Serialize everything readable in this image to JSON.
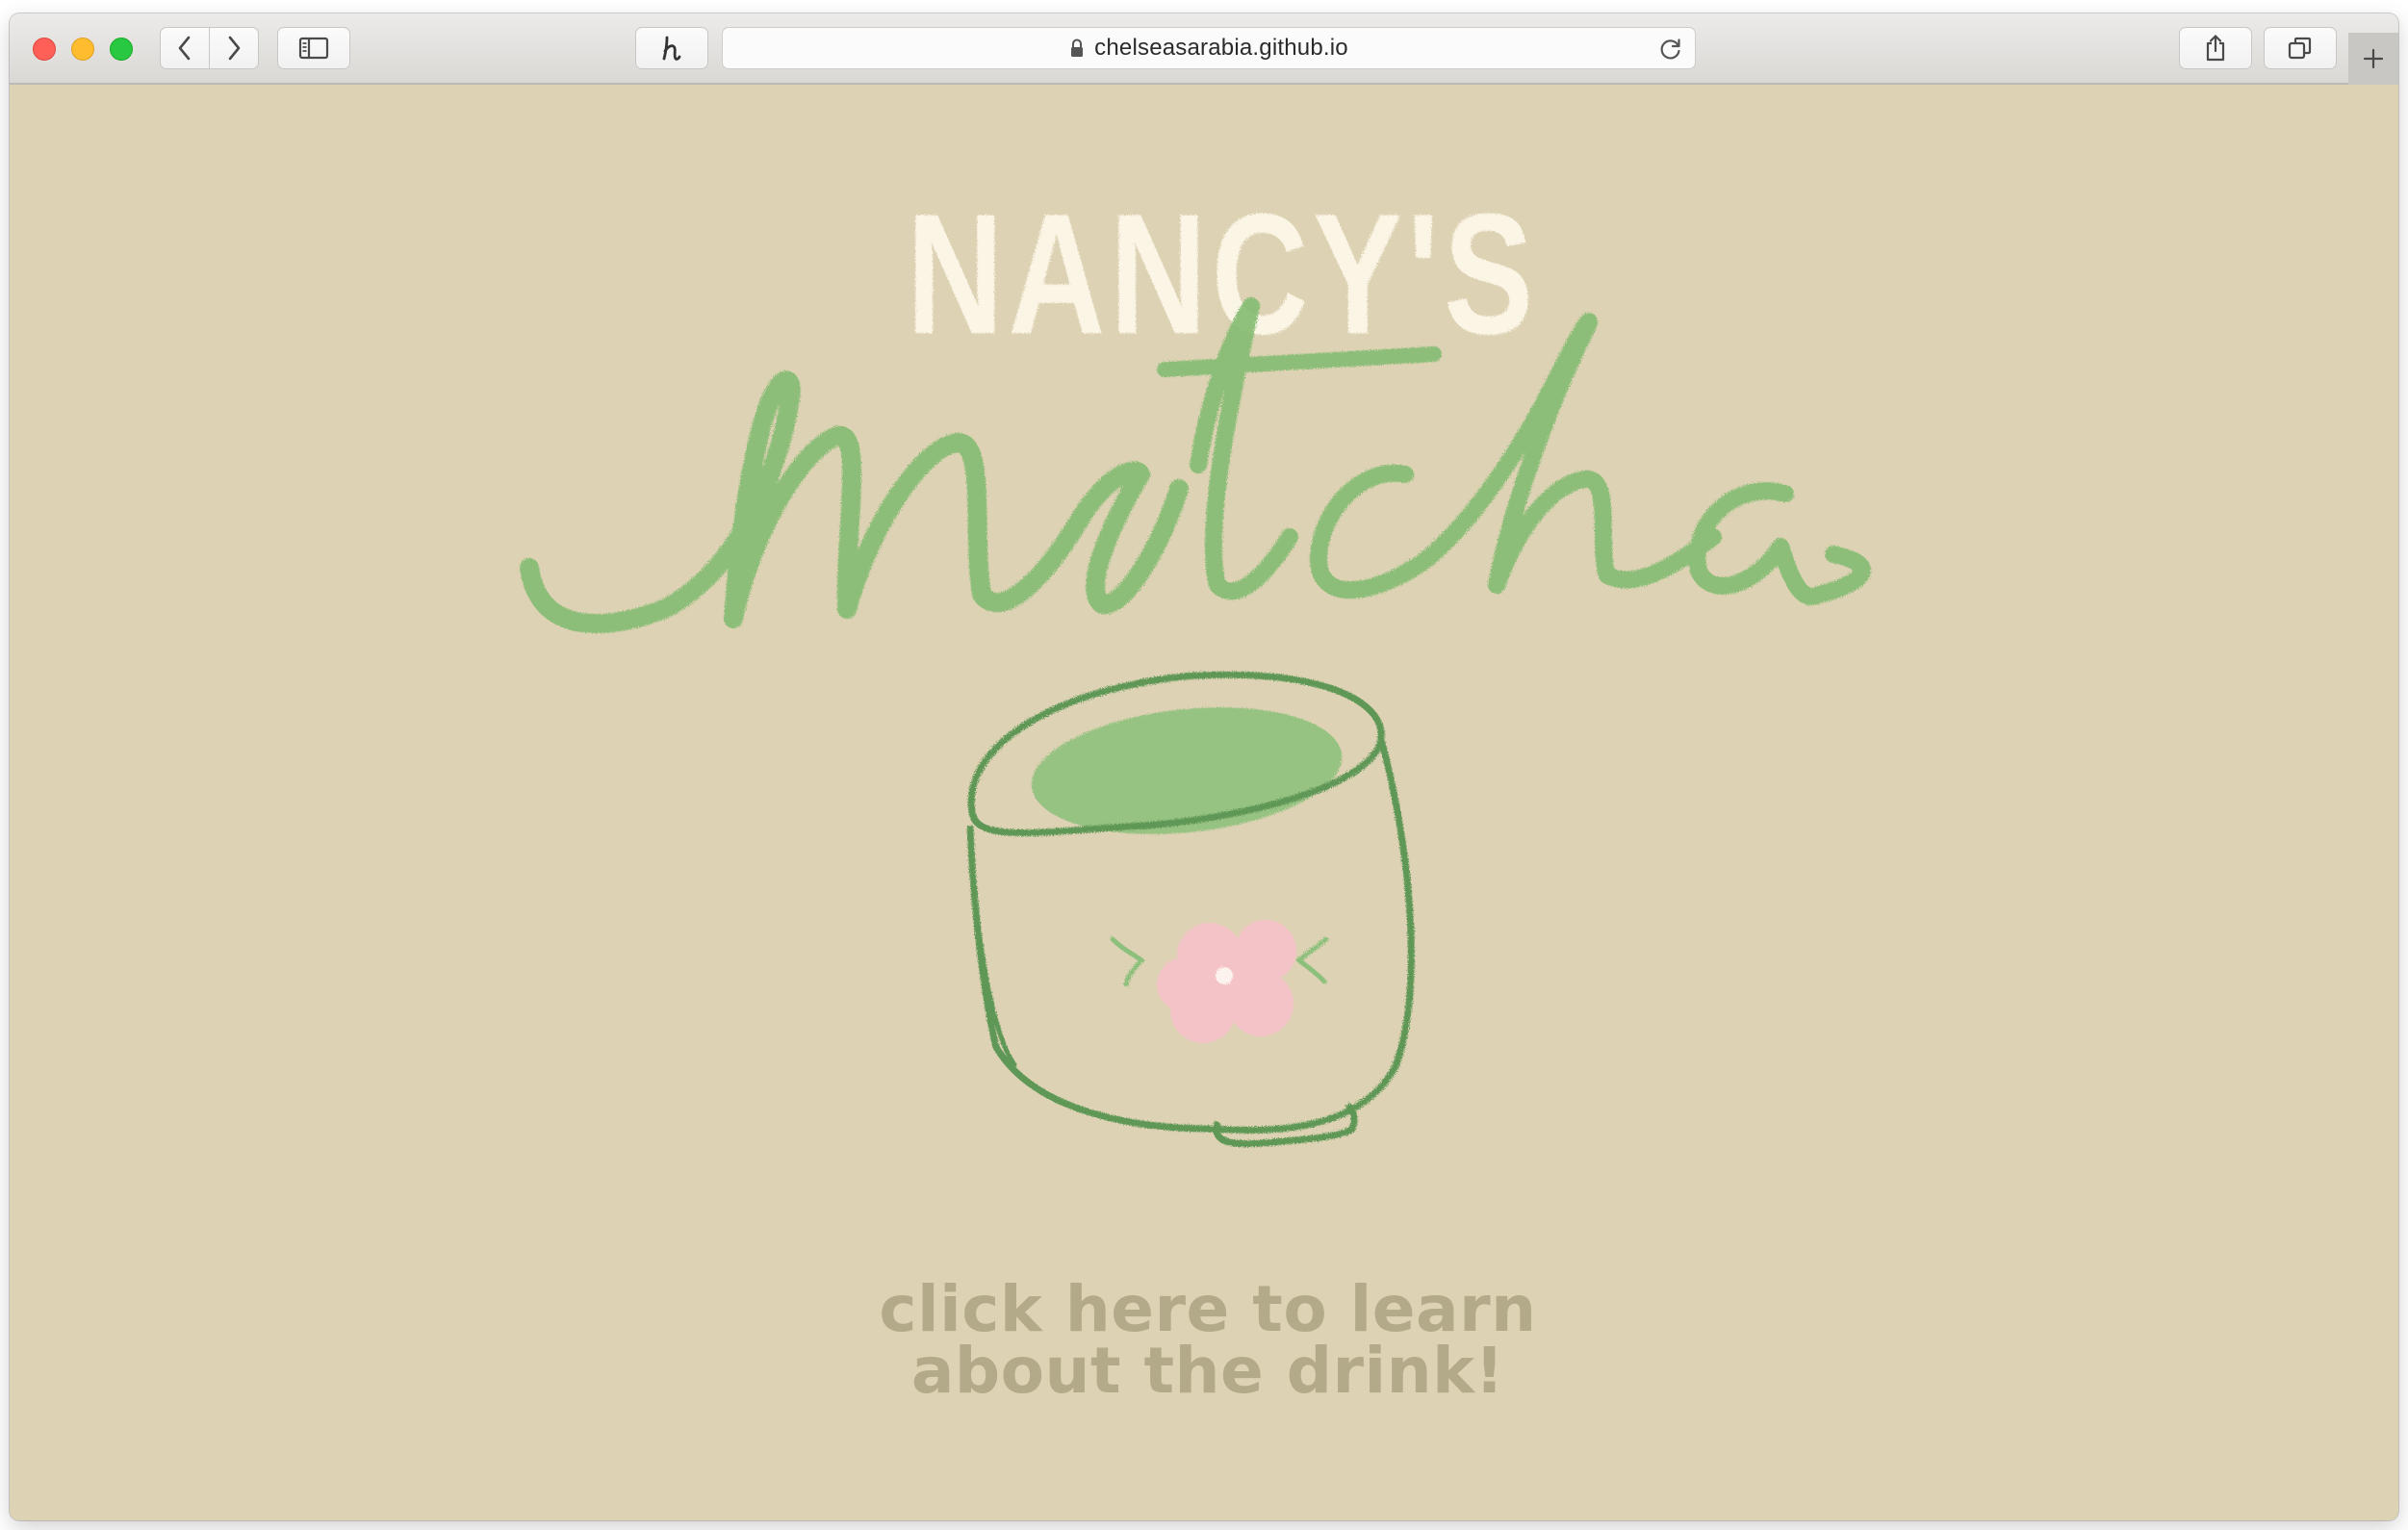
{
  "browser": {
    "address": "chelseasarabia.github.io",
    "icons": {
      "back": "chevron-left-icon",
      "forward": "chevron-right-icon",
      "sidebar": "sidebar-icon",
      "extension": "honey-extension-icon",
      "lock": "lock-icon",
      "reload": "reload-icon",
      "share": "share-icon",
      "tabs": "tab-overview-icon",
      "new_tab": "plus-icon"
    }
  },
  "page": {
    "background_color": "#ddd2b3",
    "logo": {
      "line1": "NANCY'S",
      "line2": "matcha",
      "line1_color": "#fbf5e6",
      "line2_color": "#86bd74"
    },
    "illustration": "matcha-bowl-with-pink-flower",
    "cta": {
      "text": "click here to learn about the drink!",
      "color": "#b3aa8a"
    }
  }
}
